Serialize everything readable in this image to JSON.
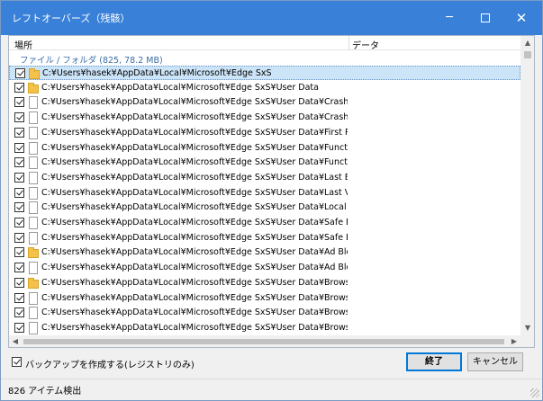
{
  "window": {
    "title": "レフトオーバーズ（残骸）",
    "controls": {
      "minimize": "─",
      "close": "✕"
    }
  },
  "columns": {
    "location": "場所",
    "data": "データ"
  },
  "group_label": "ファイル / フォルダ (825, 78.2 MB)",
  "rows": [
    {
      "icon": "folder-icon",
      "checked": true,
      "selected": true,
      "path": "C:¥Users¥hasek¥AppData¥Local¥Microsoft¥Edge SxS"
    },
    {
      "icon": "folder-icon",
      "checked": true,
      "selected": false,
      "path": "C:¥Users¥hasek¥AppData¥Local¥Microsoft¥Edge SxS¥User Data"
    },
    {
      "icon": "file-icon",
      "checked": true,
      "selected": false,
      "path": "C:¥Users¥hasek¥AppData¥Local¥Microsoft¥Edge SxS¥User Data¥CrashpadMetrics-a..."
    },
    {
      "icon": "file-icon",
      "checked": true,
      "selected": false,
      "path": "C:¥Users¥hasek¥AppData¥Local¥Microsoft¥Edge SxS¥User Data¥CrashpadMetrics.pma"
    },
    {
      "icon": "file-icon",
      "checked": true,
      "selected": false,
      "path": "C:¥Users¥hasek¥AppData¥Local¥Microsoft¥Edge SxS¥User Data¥First Run"
    },
    {
      "icon": "file-icon",
      "checked": true,
      "selected": false,
      "path": "C:¥Users¥hasek¥AppData¥Local¥Microsoft¥Edge SxS¥User Data¥Functional Data"
    },
    {
      "icon": "file-icon",
      "checked": true,
      "selected": false,
      "path": "C:¥Users¥hasek¥AppData¥Local¥Microsoft¥Edge SxS¥User Data¥Functional SAN Data"
    },
    {
      "icon": "file-icon",
      "checked": true,
      "selected": false,
      "path": "C:¥Users¥hasek¥AppData¥Local¥Microsoft¥Edge SxS¥User Data¥Last Browser"
    },
    {
      "icon": "file-icon",
      "checked": true,
      "selected": false,
      "path": "C:¥Users¥hasek¥AppData¥Local¥Microsoft¥Edge SxS¥User Data¥Last Version"
    },
    {
      "icon": "file-icon",
      "checked": true,
      "selected": false,
      "path": "C:¥Users¥hasek¥AppData¥Local¥Microsoft¥Edge SxS¥User Data¥Local State"
    },
    {
      "icon": "file-icon",
      "checked": true,
      "selected": false,
      "path": "C:¥Users¥hasek¥AppData¥Local¥Microsoft¥Edge SxS¥User Data¥Safe Browsing Coo..."
    },
    {
      "icon": "file-icon",
      "checked": true,
      "selected": false,
      "path": "C:¥Users¥hasek¥AppData¥Local¥Microsoft¥Edge SxS¥User Data¥Safe Browsing Coo..."
    },
    {
      "icon": "folder-icon",
      "checked": true,
      "selected": false,
      "path": "C:¥Users¥hasek¥AppData¥Local¥Microsoft¥Edge SxS¥User Data¥Ad Blocking"
    },
    {
      "icon": "file-icon",
      "checked": true,
      "selected": false,
      "path": "C:¥Users¥hasek¥AppData¥Local¥Microsoft¥Edge SxS¥User Data¥Ad Blocking¥blocklist"
    },
    {
      "icon": "folder-icon",
      "checked": true,
      "selected": false,
      "path": "C:¥Users¥hasek¥AppData¥Local¥Microsoft¥Edge SxS¥User Data¥BrowserMetrics"
    },
    {
      "icon": "file-icon",
      "checked": true,
      "selected": false,
      "path": "C:¥Users¥hasek¥AppData¥Local¥Microsoft¥Edge SxS¥User Data¥BrowserMetrics¥Br..."
    },
    {
      "icon": "file-icon",
      "checked": true,
      "selected": false,
      "path": "C:¥Users¥hasek¥AppData¥Local¥Microsoft¥Edge SxS¥User Data¥BrowserMetrics¥Br..."
    },
    {
      "icon": "file-icon",
      "checked": true,
      "selected": false,
      "path": "C:¥Users¥hasek¥AppData¥Local¥Microsoft¥Edge SxS¥User Data¥BrowserMetrics¥Br..."
    }
  ],
  "backup_option": {
    "label": "バックアップを作成する(レジストリのみ)",
    "checked": true
  },
  "buttons": {
    "finish": "終了",
    "cancel": "キャンセル"
  },
  "status": "826 アイテム検出"
}
